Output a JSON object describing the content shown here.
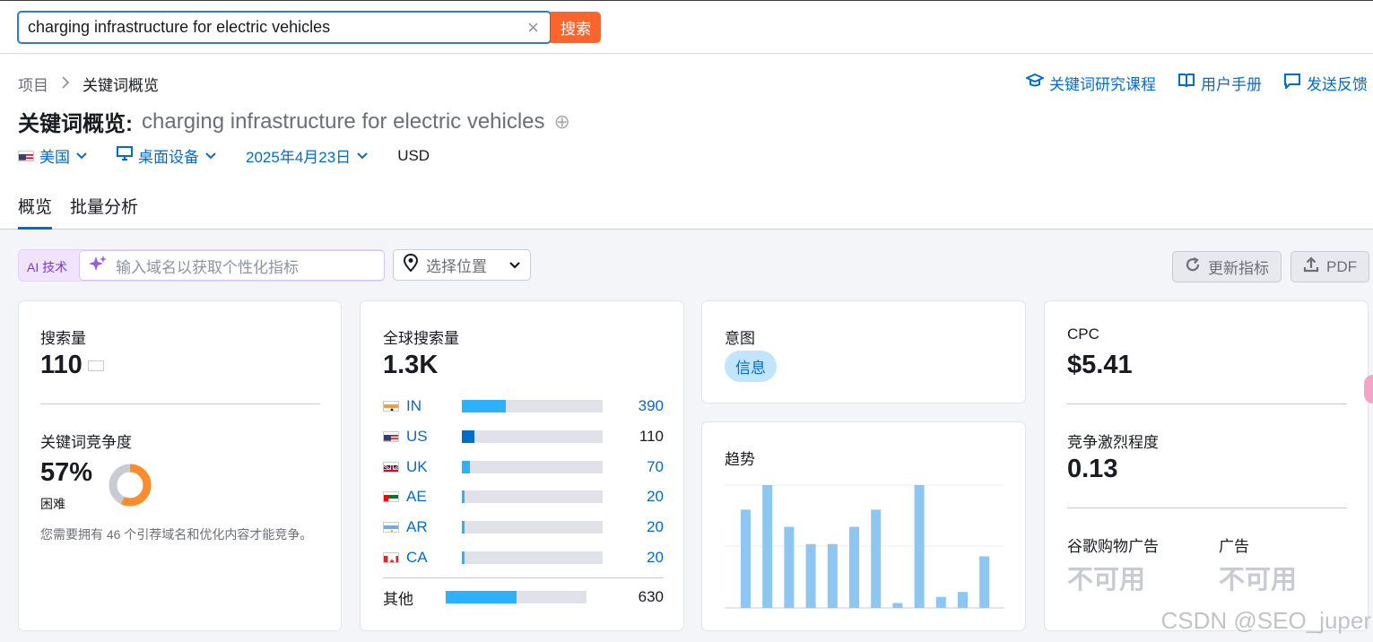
{
  "search": {
    "query": "charging infrastructure for electric vehicles",
    "button": "搜索",
    "clear": "×"
  },
  "breadcrumb": {
    "root": "项目",
    "current": "关键词概览"
  },
  "toplinks": [
    {
      "label": "关键词研究课程",
      "icon": "graduation-cap-icon"
    },
    {
      "label": "用户手册",
      "icon": "book-icon"
    },
    {
      "label": "发送反馈",
      "icon": "feedback-icon"
    }
  ],
  "title": {
    "label": "关键词概览:",
    "keyword": "charging infrastructure for electric vehicles",
    "add": "⊕"
  },
  "filters": {
    "country": "美国",
    "device": "桌面设备",
    "date": "2025年4月23日",
    "currency": "USD"
  },
  "tabs": [
    "概览",
    "批量分析"
  ],
  "toolbar": {
    "ai_tag": "AI 技术",
    "ai_placeholder": "输入域名以获取个性化指标",
    "location": "选择位置",
    "update": "更新指标",
    "pdf": "PDF"
  },
  "volume": {
    "title": "搜索量",
    "value": "110",
    "kd_title": "关键词竞争度",
    "kd_value": "57%",
    "kd_label": "困难",
    "kd_percent": 57,
    "kd_note": "您需要拥有 46 个引荐域名和优化内容才能竞争。"
  },
  "global": {
    "title": "全球搜索量",
    "value": "1.3K",
    "countries": [
      {
        "code": "IN",
        "value": "390",
        "share": 0.31,
        "color": "#2cb1ff",
        "flag": "in"
      },
      {
        "code": "US",
        "value": "110",
        "share": 0.09,
        "color": "#006dca",
        "flag": "us"
      },
      {
        "code": "UK",
        "value": "70",
        "share": 0.055,
        "color": "#2cb1ff",
        "flag": "uk"
      },
      {
        "code": "AE",
        "value": "20",
        "share": 0.02,
        "color": "#2cb1ff",
        "flag": "ae"
      },
      {
        "code": "AR",
        "value": "20",
        "share": 0.02,
        "color": "#2cb1ff",
        "flag": "ar"
      },
      {
        "code": "CA",
        "value": "20",
        "share": 0.02,
        "color": "#2cb1ff",
        "flag": "ca"
      }
    ],
    "other": {
      "label": "其他",
      "value": "630",
      "share": 0.5
    }
  },
  "intent": {
    "title": "意图",
    "badge": "信息"
  },
  "trend": {
    "title": "趋势",
    "chart_data": {
      "type": "bar",
      "values": [
        0.8,
        1.0,
        0.66,
        0.52,
        0.52,
        0.66,
        0.8,
        0.04,
        1.0,
        0.09,
        0.13,
        0.42
      ]
    }
  },
  "cpc": {
    "title": "CPC",
    "value": "$5.41",
    "comp_title": "竞争激烈程度",
    "comp_value": "0.13",
    "shopping_title": "谷歌购物广告",
    "shopping_value": "不可用",
    "ads_title": "广告",
    "ads_value": "不可用"
  },
  "watermark": "CSDN @SEO_juper"
}
